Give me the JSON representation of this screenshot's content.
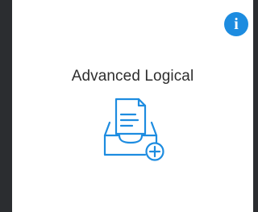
{
  "card": {
    "title": "Advanced Logical",
    "icon": "document-inbox-add-icon",
    "info_icon": "info-icon",
    "info_glyph": "i"
  },
  "colors": {
    "background": "#2b2d30",
    "card": "#ffffff",
    "accent": "#1d8ce0",
    "title_text": "#2e2e2e"
  }
}
